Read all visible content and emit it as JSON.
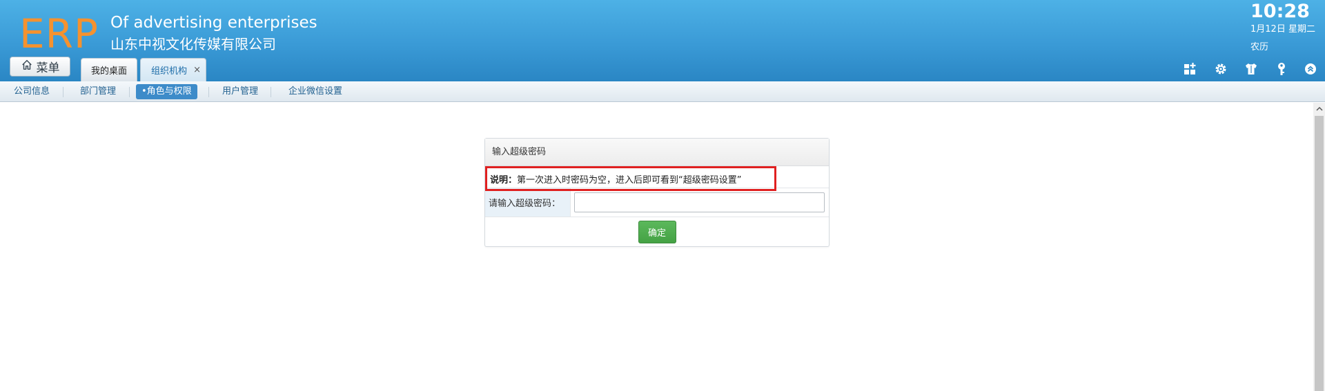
{
  "header": {
    "logo": "ERP",
    "company_en": "Of advertising enterprises",
    "company_cn": "山东中视文化传媒有限公司",
    "clock": {
      "time": "10:28",
      "date": "1月12日 星期二",
      "lunar": "农历"
    },
    "menu_label": "菜单",
    "tabs": [
      {
        "label": "我的桌面",
        "active": false
      },
      {
        "label": "组织机构",
        "active": true,
        "close": "×"
      }
    ],
    "icons": [
      "grid-add-icon",
      "gear-icon",
      "shirt-icon",
      "key-icon",
      "collapse-up-icon"
    ]
  },
  "subnav": {
    "items": [
      {
        "label": "公司信息"
      },
      {
        "label": "部门管理"
      },
      {
        "label": "•角色与权限",
        "active": true
      },
      {
        "label": "用户管理"
      },
      {
        "label": "企业微信设置"
      }
    ]
  },
  "panel": {
    "title": "输入超级密码",
    "note_label": "说明：",
    "note_text": "第一次进入时密码为空，进入后即可看到“超级密码设置”",
    "password_label": "请输入超级密码：",
    "password_value": "",
    "confirm_label": "确定"
  },
  "colors": {
    "header_top": "#4db1e6",
    "header_bottom": "#2a86c4",
    "logo": "#f5922f",
    "active_nav": "#3d8bc9",
    "confirm_button": "#5cb85c",
    "highlight_border": "#e02020"
  }
}
